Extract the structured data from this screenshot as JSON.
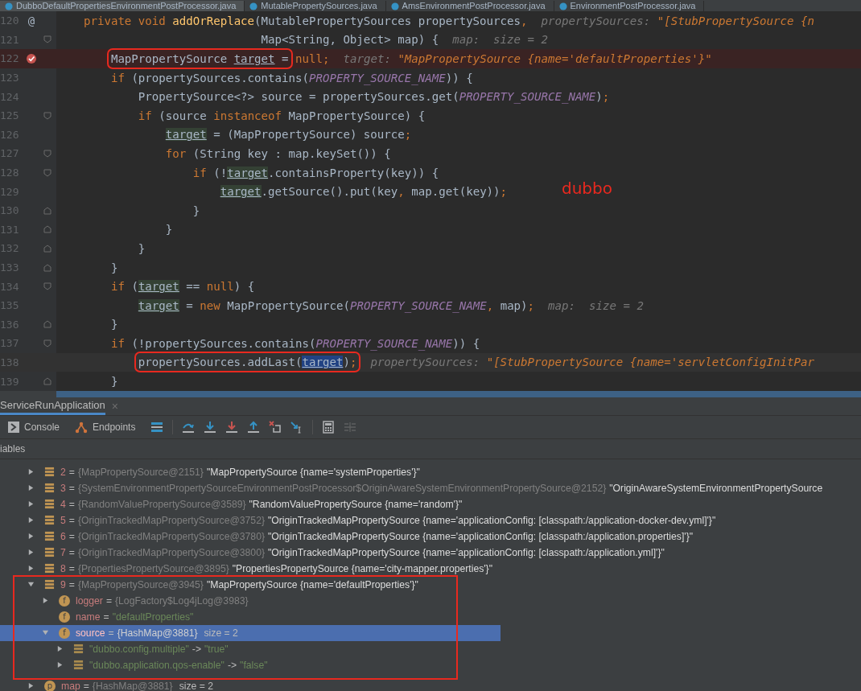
{
  "editor_tabs": [
    {
      "label": "DubboDefaultPropertiesEnvironmentPostProcessor.java",
      "selected": true
    },
    {
      "label": "MutablePropertySources.java",
      "selected": false
    },
    {
      "label": "AmsEnvironmentPostProcessor.java",
      "selected": false
    },
    {
      "label": "EnvironmentPostProcessor.java",
      "selected": false
    }
  ],
  "code_lines": [
    {
      "num": "120",
      "kind": "normal",
      "gutter_mark": "@",
      "tokens": [
        {
          "kind": "kw",
          "text": "    private void "
        },
        {
          "kind": "fn",
          "text": "addOrReplace"
        },
        {
          "kind": "plain",
          "text": "(MutablePropertySources propertySources"
        },
        {
          "kind": "punct",
          "text": ","
        },
        {
          "kind": "hint-label",
          "text": "  propertySources: "
        },
        {
          "kind": "hint-str",
          "text": "\"[StubPropertySource {n"
        }
      ]
    },
    {
      "num": "121",
      "kind": "normal",
      "fold_open": true,
      "tokens": [
        {
          "kind": "plain",
          "text": "                              Map<String, Object> map) {"
        },
        {
          "kind": "hint-label",
          "text": "  map:  size = 2"
        }
      ]
    },
    {
      "num": "122",
      "kind": "breakpoint",
      "breakpoint": true,
      "tokens": [
        {
          "kind": "box",
          "tokens": [
            {
              "kind": "plain",
              "text": "        MapPropertySource "
            },
            {
              "kind": "var",
              "text": "target"
            },
            {
              "kind": "plain",
              "text": " ="
            }
          ]
        },
        {
          "kind": "kw",
          "text": " null"
        },
        {
          "kind": "punct",
          "text": ";"
        },
        {
          "kind": "hint-label",
          "text": "  target: "
        },
        {
          "kind": "hint-str",
          "text": "\"MapPropertySource {name='defaultProperties'}\""
        }
      ]
    },
    {
      "num": "123",
      "kind": "normal",
      "tokens": [
        {
          "kind": "kw",
          "text": "        if"
        },
        {
          "kind": "plain",
          "text": " (propertySources.contains("
        },
        {
          "kind": "const",
          "text": "PROPERTY_SOURCE_NAME"
        },
        {
          "kind": "plain",
          "text": ")) {"
        }
      ]
    },
    {
      "num": "124",
      "kind": "normal",
      "tokens": [
        {
          "kind": "plain",
          "text": "            PropertySource<?> source = propertySources.get("
        },
        {
          "kind": "const",
          "text": "PROPERTY_SOURCE_NAME"
        },
        {
          "kind": "plain",
          "text": ")"
        },
        {
          "kind": "punct",
          "text": ";"
        }
      ]
    },
    {
      "num": "125",
      "kind": "normal",
      "fold_open": true,
      "tokens": [
        {
          "kind": "kw",
          "text": "            if"
        },
        {
          "kind": "plain",
          "text": " (source "
        },
        {
          "kind": "kw",
          "text": "instanceof"
        },
        {
          "kind": "plain",
          "text": " MapPropertySource) {"
        }
      ]
    },
    {
      "num": "126",
      "kind": "normal",
      "tokens": [
        {
          "kind": "var-hl",
          "text": "                target"
        },
        {
          "kind": "plain",
          "text": " = (MapPropertySource) source"
        },
        {
          "kind": "punct",
          "text": ";"
        }
      ]
    },
    {
      "num": "127",
      "kind": "normal",
      "fold_open": true,
      "tokens": [
        {
          "kind": "kw",
          "text": "                for"
        },
        {
          "kind": "plain",
          "text": " (String key : map.keySet()) {"
        }
      ]
    },
    {
      "num": "128",
      "kind": "normal",
      "fold_open": true,
      "tokens": [
        {
          "kind": "kw",
          "text": "                    if"
        },
        {
          "kind": "plain",
          "text": " (!"
        },
        {
          "kind": "var-hl",
          "text": "target"
        },
        {
          "kind": "plain",
          "text": ".containsProperty(key)) {"
        }
      ]
    },
    {
      "num": "129",
      "kind": "normal",
      "tokens": [
        {
          "kind": "var-hl",
          "text": "                        target"
        },
        {
          "kind": "plain",
          "text": ".getSource().put(key"
        },
        {
          "kind": "punct",
          "text": ","
        },
        {
          "kind": "plain",
          "text": " map.get(key))"
        },
        {
          "kind": "punct",
          "text": ";"
        }
      ]
    },
    {
      "num": "130",
      "kind": "normal",
      "fold_close": true,
      "tokens": [
        {
          "kind": "plain",
          "text": "                    }"
        }
      ]
    },
    {
      "num": "131",
      "kind": "normal",
      "fold_close": true,
      "tokens": [
        {
          "kind": "plain",
          "text": "                }"
        }
      ]
    },
    {
      "num": "132",
      "kind": "normal",
      "fold_close": true,
      "tokens": [
        {
          "kind": "plain",
          "text": "            }"
        }
      ]
    },
    {
      "num": "133",
      "kind": "normal",
      "fold_close": true,
      "tokens": [
        {
          "kind": "plain",
          "text": "        }"
        }
      ]
    },
    {
      "num": "134",
      "kind": "normal",
      "fold_open": true,
      "tokens": [
        {
          "kind": "kw",
          "text": "        if"
        },
        {
          "kind": "plain",
          "text": " ("
        },
        {
          "kind": "var-hl",
          "text": "target"
        },
        {
          "kind": "plain",
          "text": " == "
        },
        {
          "kind": "kw",
          "text": "null"
        },
        {
          "kind": "plain",
          "text": ") {"
        }
      ]
    },
    {
      "num": "135",
      "kind": "normal",
      "tokens": [
        {
          "kind": "var-hl",
          "text": "            target"
        },
        {
          "kind": "plain",
          "text": " = "
        },
        {
          "kind": "kw",
          "text": "new"
        },
        {
          "kind": "plain",
          "text": " MapPropertySource("
        },
        {
          "kind": "const",
          "text": "PROPERTY_SOURCE_NAME"
        },
        {
          "kind": "punct",
          "text": ","
        },
        {
          "kind": "plain",
          "text": " map)"
        },
        {
          "kind": "punct",
          "text": ";"
        },
        {
          "kind": "hint-label",
          "text": "  map:  size = 2"
        }
      ]
    },
    {
      "num": "136",
      "kind": "normal",
      "fold_close": true,
      "tokens": [
        {
          "kind": "plain",
          "text": "        }"
        }
      ]
    },
    {
      "num": "137",
      "kind": "normal",
      "fold_open": true,
      "tokens": [
        {
          "kind": "kw",
          "text": "        if"
        },
        {
          "kind": "plain",
          "text": " (!propertySources.contains("
        },
        {
          "kind": "const",
          "text": "PROPERTY_SOURCE_NAME"
        },
        {
          "kind": "plain",
          "text": ")) {"
        }
      ]
    },
    {
      "num": "138",
      "kind": "current",
      "tokens": [
        {
          "kind": "box",
          "tokens": [
            {
              "kind": "plain",
              "text": "            propertySources.addLast("
            },
            {
              "kind": "var-sel",
              "text": "target"
            },
            {
              "kind": "plain",
              "text": ")"
            },
            {
              "kind": "punct",
              "text": ";"
            }
          ]
        },
        {
          "kind": "hint-label",
          "text": "  propertySources: "
        },
        {
          "kind": "hint-str",
          "text": "\"[StubPropertySource {name='servletConfigInitPar"
        }
      ]
    },
    {
      "num": "139",
      "kind": "normal",
      "fold_close": true,
      "tokens": [
        {
          "kind": "plain",
          "text": "        }"
        }
      ]
    }
  ],
  "annotation": "dubbo",
  "debug": {
    "title": "ServiceRunApplication",
    "close": "×",
    "tabs": [
      {
        "label": "Console",
        "kind": "console"
      },
      {
        "label": "Endpoints",
        "kind": "endpoints"
      }
    ],
    "variables_header": "iables",
    "variables": [
      {
        "kind": "array",
        "name": "2",
        "op": "=",
        "type": "{MapPropertySource@2151}",
        "value": "\"MapPropertySource {name='systemProperties'}\"",
        "expanded": false,
        "selected": false
      },
      {
        "kind": "array",
        "name": "3",
        "op": "=",
        "type": "{SystemEnvironmentPropertySourceEnvironmentPostProcessor$OriginAwareSystemEnvironmentPropertySource@2152}",
        "value": "\"OriginAwareSystemEnvironmentPropertySource",
        "expanded": false,
        "selected": false
      },
      {
        "kind": "array",
        "name": "4",
        "op": "=",
        "type": "{RandomValuePropertySource@3589}",
        "value": "\"RandomValuePropertySource {name='random'}\"",
        "expanded": false,
        "selected": false
      },
      {
        "kind": "array",
        "name": "5",
        "op": "=",
        "type": "{OriginTrackedMapPropertySource@3752}",
        "value": "\"OriginTrackedMapPropertySource {name='applicationConfig: [classpath:/application-docker-dev.yml]'}\"",
        "expanded": false,
        "selected": false
      },
      {
        "kind": "array",
        "name": "6",
        "op": "=",
        "type": "{OriginTrackedMapPropertySource@3780}",
        "value": "\"OriginTrackedMapPropertySource {name='applicationConfig: [classpath:/application.properties]'}\"",
        "expanded": false,
        "selected": false
      },
      {
        "kind": "array",
        "name": "7",
        "op": "=",
        "type": "{OriginTrackedMapPropertySource@3800}",
        "value": "\"OriginTrackedMapPropertySource {name='applicationConfig: [classpath:/application.yml]'}\"",
        "expanded": false,
        "selected": false
      },
      {
        "kind": "array",
        "name": "8",
        "op": "=",
        "type": "{PropertiesPropertySource@3895}",
        "value": "\"PropertiesPropertySource {name='city-mapper.properties'}\"",
        "expanded": false,
        "selected": false
      },
      {
        "kind": "array",
        "name": "9",
        "op": "=",
        "type": "{MapPropertySource@3945}",
        "value": "\"MapPropertySource {name='defaultProperties'}\"",
        "expanded": true,
        "selected": false,
        "annotated": true,
        "children": [
          {
            "kind": "field",
            "badge": "f",
            "name": "logger",
            "op": "=",
            "type": "{LogFactory$Log4jLog@3983}",
            "expanded": false,
            "selected": false
          },
          {
            "kind": "field",
            "badge": "f",
            "name": "name",
            "op": "=",
            "string": "\"defaultProperties\"",
            "selected": false
          },
          {
            "kind": "field",
            "badge": "f",
            "name": "source",
            "op": "=",
            "type": "{HashMap@3881}",
            "extra": "size = 2",
            "expanded": true,
            "selected": true,
            "children": [
              {
                "kind": "entry",
                "name": "\"dubbo.config.multiple\"",
                "op": "->",
                "string": "\"true\"",
                "expanded": false,
                "selected": false
              },
              {
                "kind": "entry",
                "name": "\"dubbo.application.qos-enable\"",
                "op": "->",
                "string": "\"false\"",
                "expanded": false,
                "selected": false
              }
            ]
          }
        ]
      },
      {
        "kind": "field",
        "badge": "p",
        "name": "map",
        "op": "=",
        "type": "{HashMap@3881}",
        "extra": "size = 2",
        "expanded": false,
        "selected": false
      }
    ]
  }
}
